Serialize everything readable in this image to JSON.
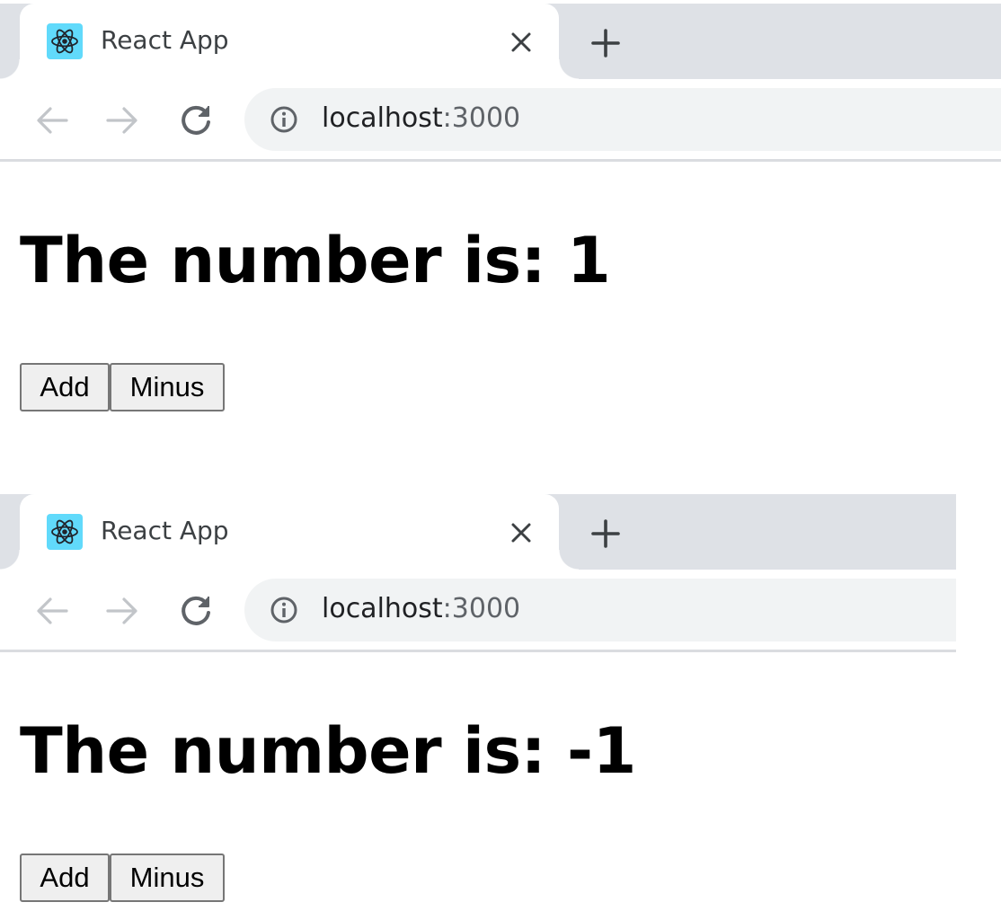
{
  "screenshots": [
    {
      "tab": {
        "title": "React App",
        "favicon": "react-logo-icon"
      },
      "address_bar": {
        "host": "localhost",
        "port": ":3000"
      },
      "page": {
        "heading": "The number is: 1",
        "buttons": {
          "add": "Add",
          "minus": "Minus"
        }
      }
    },
    {
      "tab": {
        "title": "React App",
        "favicon": "react-logo-icon"
      },
      "address_bar": {
        "host": "localhost",
        "port": ":3000"
      },
      "page": {
        "heading": "The number is: -1",
        "buttons": {
          "add": "Add",
          "minus": "Minus"
        }
      }
    }
  ],
  "colors": {
    "tabstrip": "#dee1e6",
    "omnibox": "#f1f3f4",
    "react_blue": "#61dafb",
    "button_bg": "#efefef",
    "button_border": "#767676"
  }
}
